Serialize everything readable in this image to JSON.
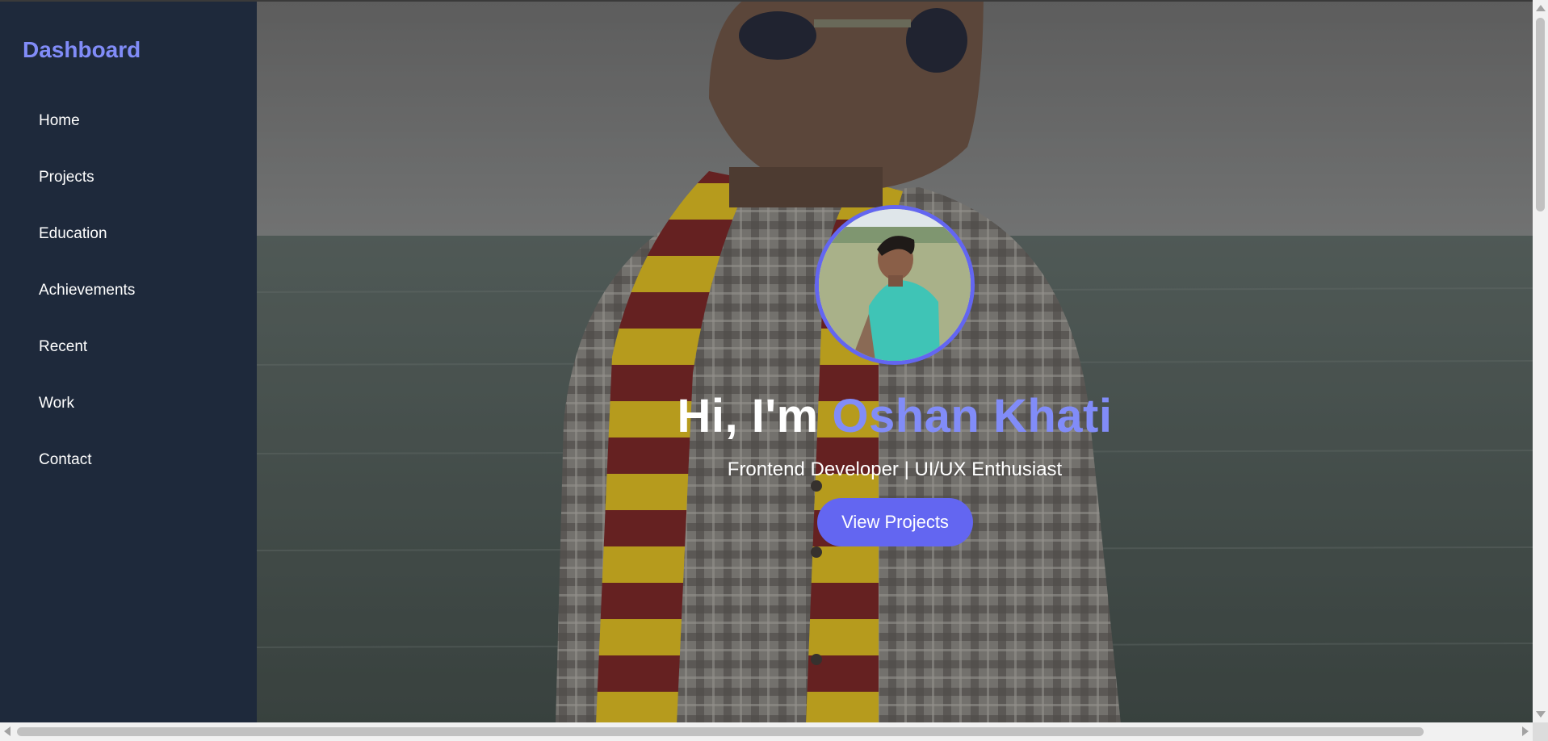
{
  "sidebar": {
    "brand": "Dashboard",
    "items": [
      {
        "label": "Home"
      },
      {
        "label": "Projects"
      },
      {
        "label": "Education"
      },
      {
        "label": "Achievements"
      },
      {
        "label": "Recent"
      },
      {
        "label": "Work"
      },
      {
        "label": "Contact"
      }
    ]
  },
  "hero": {
    "greeting": "Hi, I'm",
    "name": "Oshan Khati",
    "tagline": "Frontend Developer | UI/UX Enthusiast",
    "cta_label": "View Projects",
    "background_image": "portrait-by-sea-photo",
    "avatar_image": "profile-photo"
  },
  "colors": {
    "sidebar_bg": "#1e293b",
    "accent": "#6366f1",
    "accent_text": "#818cf8"
  }
}
